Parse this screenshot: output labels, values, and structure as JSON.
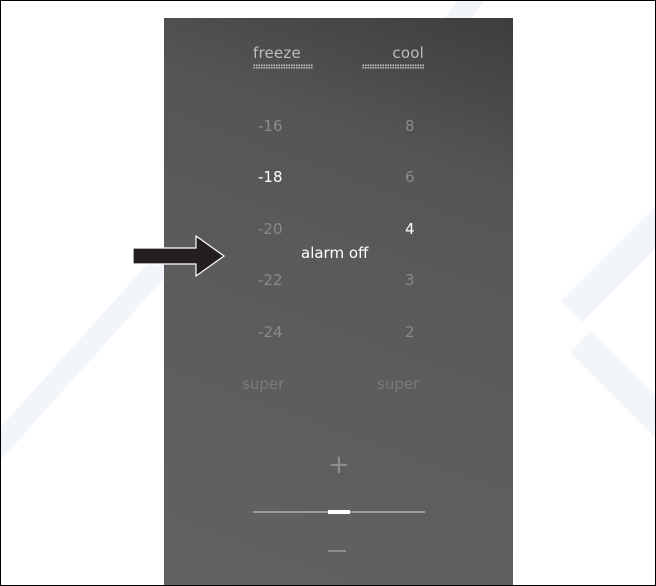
{
  "header": {
    "freeze_label": "freeze",
    "cool_label": "cool"
  },
  "freeze_values": [
    "-16",
    "-18",
    "-20",
    "-22",
    "-24",
    "super"
  ],
  "cool_values": [
    "8",
    "6",
    "4",
    "3",
    "2",
    "super"
  ],
  "freeze_selected": "-18",
  "cool_selected": "4",
  "alarm_text": "alarm off",
  "controls": {
    "plus_symbol": "+",
    "slider_position": 0.5
  },
  "colors": {
    "panel": "#5a5a5a",
    "active_text": "#ffffff",
    "inactive_text": "#8a8a8a",
    "arrow": "#231f20"
  },
  "icons": {
    "pointer": "arrow-right-icon",
    "increase": "plus-icon",
    "decrease": "minus-icon"
  }
}
